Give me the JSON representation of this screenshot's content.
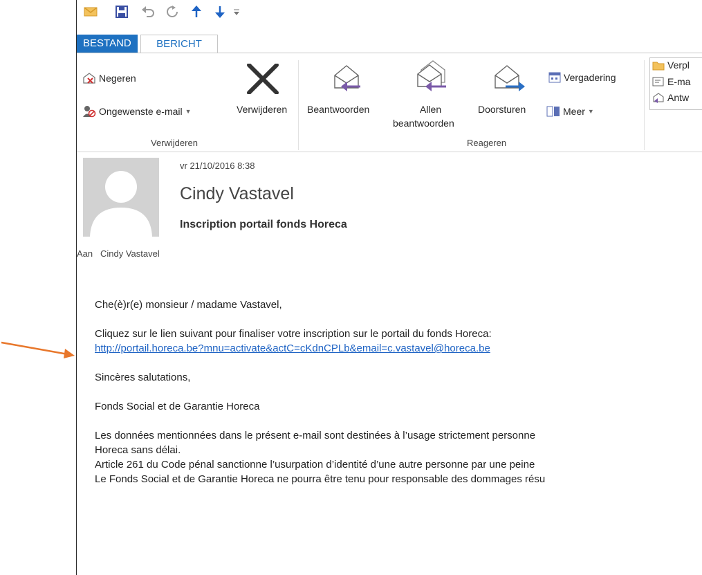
{
  "qat": {
    "icons": [
      "mail-icon",
      "save-icon",
      "undo-icon",
      "redo-icon",
      "up-arrow-icon",
      "down-arrow-icon",
      "customize-qat-icon"
    ]
  },
  "tabs": {
    "file": "BESTAND",
    "message": "BERICHT"
  },
  "ribbon": {
    "ignore": "Negeren",
    "junk": "Ongewenste e-mail",
    "delete": "Verwijderen",
    "delete_group": "Verwijderen",
    "reply": "Beantwoorden",
    "reply_all_1": "Allen",
    "reply_all_2": "beantwoorden",
    "forward": "Doorsturen",
    "meeting": "Vergadering",
    "more": "Meer",
    "respond_group": "Reageren",
    "move": "Verpl",
    "email": "E-ma",
    "antw": "Antw"
  },
  "colors": {
    "accent": "#1e71c1",
    "link": "#1e63c4",
    "arrow": "#e8772b",
    "reply_purple": "#7a5aa8",
    "forward_blue": "#2a6fc4"
  },
  "message": {
    "date": "vr 21/10/2016 8:38",
    "sender": "Cindy Vastavel",
    "subject": "Inscription portail fonds Horeca",
    "to_label": "Aan",
    "to_value": "Cindy Vastavel",
    "greeting": "Che(è)r(e) monsieur / madame Vastavel,",
    "line1": "Cliquez sur le lien suivant pour finaliser votre inscription sur le portail du fonds Horeca:",
    "link": "http://portail.horeca.be?mnu=activate&actC=cKdnCPLb&email=c.vastavel@horeca.be",
    "closing": "Sincères salutations,",
    "signature": "Fonds Social et de Garantie Horeca",
    "disclaimer1": "Les données mentionnées dans le présent e-mail sont destinées à l’usage strictement personne",
    "disclaimer2": "Horeca sans délai.",
    "disclaimer3": "Article 261 du Code pénal sanctionne l’usurpation d’identité d’une autre personne par une peine",
    "disclaimer4": "Le Fonds Social et de Garantie Horeca ne pourra être tenu pour responsable des dommages résu"
  }
}
